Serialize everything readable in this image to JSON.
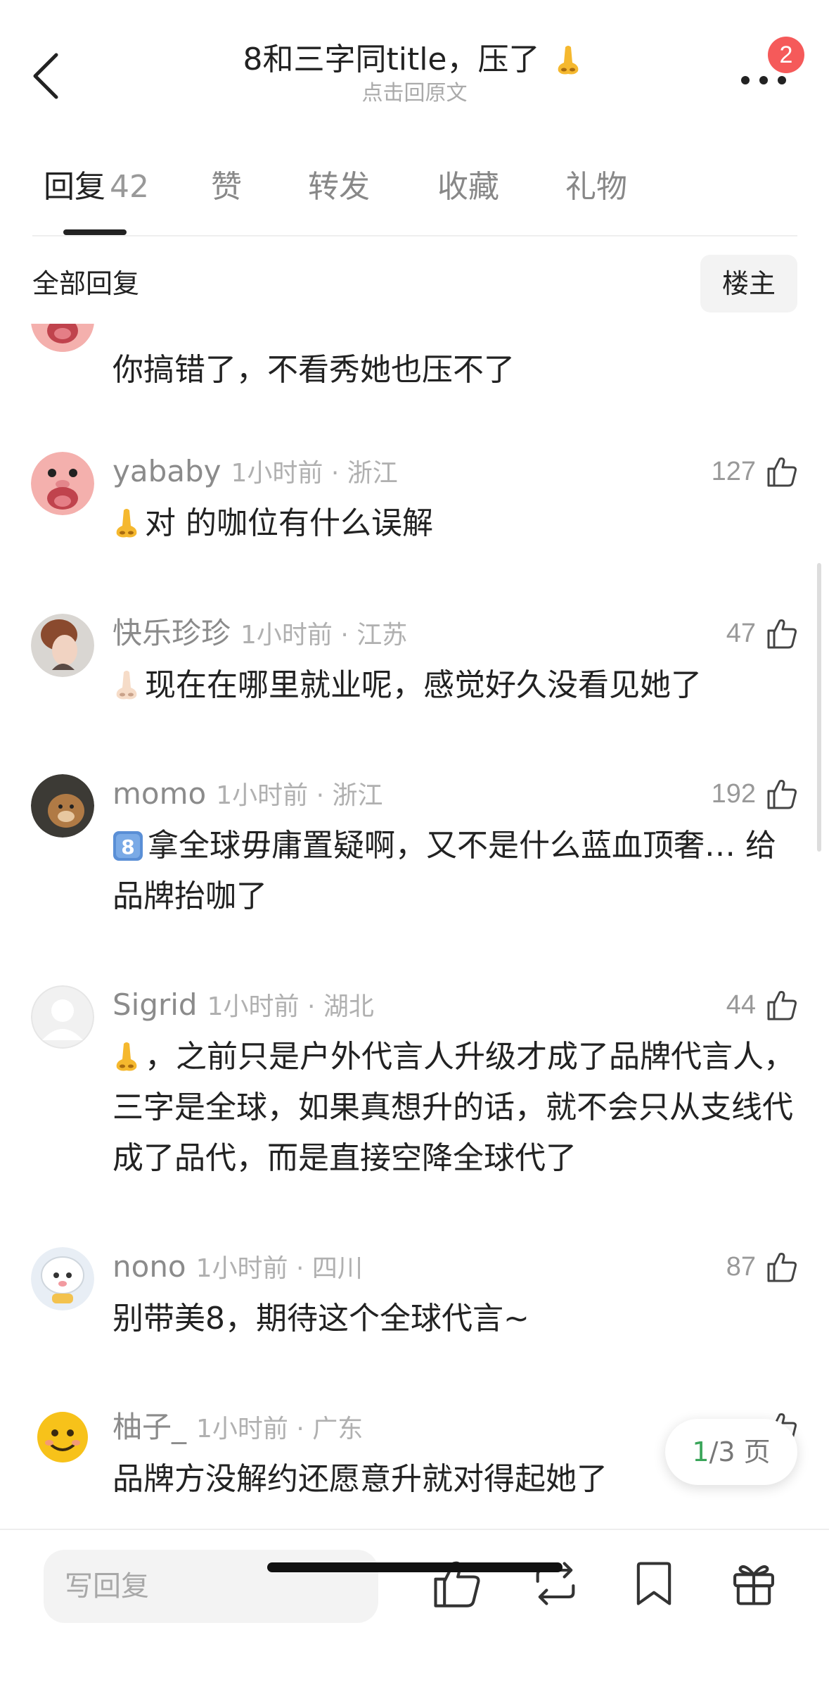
{
  "header": {
    "title": "8和三字同title，压了",
    "subtitle": "点击回原文",
    "notification_count": "2"
  },
  "tabs": [
    {
      "label": "回复",
      "count": "42"
    },
    {
      "label": "赞"
    },
    {
      "label": "转发"
    },
    {
      "label": "收藏"
    },
    {
      "label": "礼物"
    }
  ],
  "filter": {
    "label": "全部回复",
    "owner_button": "楼主"
  },
  "comments": [
    {
      "text": "你搞错了，不看秀她也压不了"
    },
    {
      "name": "yababy",
      "meta": "1小时前 · 浙江",
      "likes": "127",
      "text": "对 的咖位有什么误解",
      "emoji": "nose-yellow"
    },
    {
      "name": "快乐珍珍",
      "meta": "1小时前 · 江苏",
      "likes": "47",
      "text": "现在在哪里就业呢，感觉好久没看见她了",
      "emoji": "nose-light"
    },
    {
      "name": "momo",
      "meta": "1小时前 · 浙江",
      "likes": "192",
      "text": "拿全球毋庸置疑啊，又不是什么蓝血顶奢… 给品牌抬咖了",
      "emoji": "keycap-8"
    },
    {
      "name": "Sigrid",
      "meta": "1小时前 · 湖北",
      "likes": "44",
      "text": "，之前只是户外代言人升级才成了品牌代言人，三字是全球，如果真想升的话，就不会只从支线代成了品代，而是直接空降全球代了",
      "emoji": "nose-yellow"
    },
    {
      "name": "nono",
      "meta": "1小时前 · 四川",
      "likes": "87",
      "text": "别带美8，期待这个全球代言~"
    },
    {
      "name": "柚子_",
      "meta": "1小时前 · 广东",
      "text": "品牌方没解约还愿意升就对得起她了"
    }
  ],
  "pagination": {
    "current": "1",
    "total": "/3 页"
  },
  "bottom_bar": {
    "reply_placeholder": "写回复"
  },
  "colors": {
    "badge": "#f55a5a",
    "page_current": "#3aa55a",
    "meta_text": "#b0b0b0"
  }
}
